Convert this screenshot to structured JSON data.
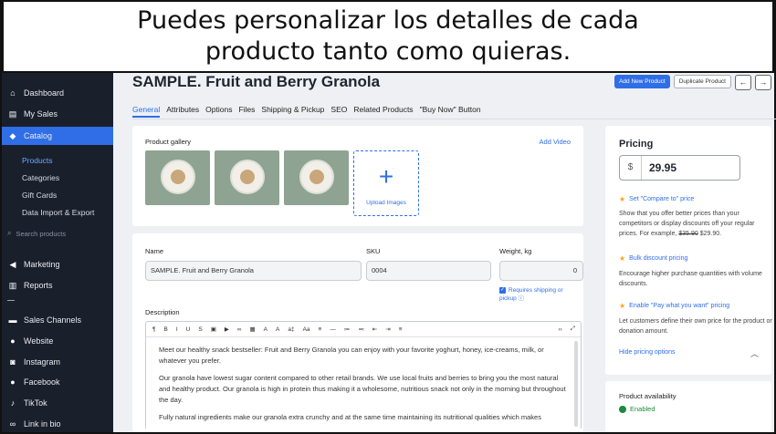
{
  "banner": {
    "line1": "Puedes personalizar los detalles de cada",
    "line2": "producto tanto como quieras."
  },
  "sidebar": {
    "items": [
      {
        "label": "Dashboard",
        "icon": "home-icon"
      },
      {
        "label": "My Sales",
        "icon": "sales-icon"
      },
      {
        "label": "Catalog",
        "icon": "tag-icon"
      },
      {
        "label": "Marketing",
        "icon": "megaphone-icon"
      },
      {
        "label": "Reports",
        "icon": "bar-chart-icon"
      },
      {
        "label": "Sales Channels",
        "icon": "channels-icon"
      },
      {
        "label": "Website",
        "icon": "globe-icon"
      },
      {
        "label": "Instagram",
        "icon": "instagram-icon"
      },
      {
        "label": "Facebook",
        "icon": "facebook-icon"
      },
      {
        "label": "TikTok",
        "icon": "tiktok-icon"
      },
      {
        "label": "Link in bio",
        "icon": "link-icon"
      }
    ],
    "catalog_sub": [
      "Products",
      "Categories",
      "Gift Cards",
      "Data Import & Export"
    ],
    "search_placeholder": "Search products"
  },
  "header": {
    "title": "SAMPLE. Fruit and Berry Granola",
    "add_product": "Add New Product",
    "duplicate": "Duplicate Product",
    "prev": "←",
    "next": "→"
  },
  "tabs": [
    "General",
    "Attributes",
    "Options",
    "Files",
    "Shipping & Pickup",
    "SEO",
    "Related Products",
    "\"Buy Now\" Button"
  ],
  "gallery": {
    "label": "Product gallery",
    "add_video": "Add Video",
    "upload": "Upload Images"
  },
  "form": {
    "name_label": "Name",
    "name_value": "SAMPLE. Fruit and Berry Granola",
    "sku_label": "SKU",
    "sku_value": "0004",
    "weight_label": "Weight, kg",
    "weight_value": "0",
    "requires_shipping": "Requires shipping or pickup",
    "description_label": "Description"
  },
  "editor": {
    "toolbar": [
      "¶",
      "B",
      "I",
      "U",
      "S",
      "▣",
      "▶",
      "∞",
      "▦",
      "A",
      "A",
      "a‡",
      "Aa",
      "≡",
      "—",
      "≔",
      "≕",
      "⇤",
      "⇥",
      "≡",
      "‹›",
      "⤢"
    ],
    "paragraphs": [
      "Meet our healthy snack bestseller: Fruit and Berry Granola you can enjoy with your favorite yoghurt, honey, ice-creams, milk, or whatever you prefer.",
      "Our granola have lowest sugar content compared to other retail brands. We use local fruits and berries to bring you the most natural and healthy product. Our granola is high in protein thus making it a wholesome, nutritious snack not only in the morning but throughout the day.",
      "Fully natural ingredients make our granola extra crunchy and at the same time maintaining its nutritional qualities which makes"
    ]
  },
  "pricing": {
    "title": "Pricing",
    "currency": "$",
    "price": "29.95",
    "compare_label": "Set \"Compare to\" price",
    "compare_desc_1": "Show that you offer better prices than your competitors or display discounts off your regular prices. For example,",
    "compare_old": "$35.90",
    "compare_new": "$29.90.",
    "bulk_label": "Bulk discount pricing",
    "bulk_desc": "Encourage higher purchase quantities with volume discounts.",
    "pwyw_label": "Enable \"Pay what you want\" pricing",
    "pwyw_desc": "Let customers define their own price for the product or donation amount.",
    "hide": "Hide pricing options"
  },
  "availability": {
    "title": "Product availability",
    "status": "Enabled"
  },
  "colors": {
    "accent": "#2f6ee6",
    "sidebar_bg": "#1a1f2c",
    "enabled": "#1b8a3e",
    "star": "#f5a623"
  }
}
